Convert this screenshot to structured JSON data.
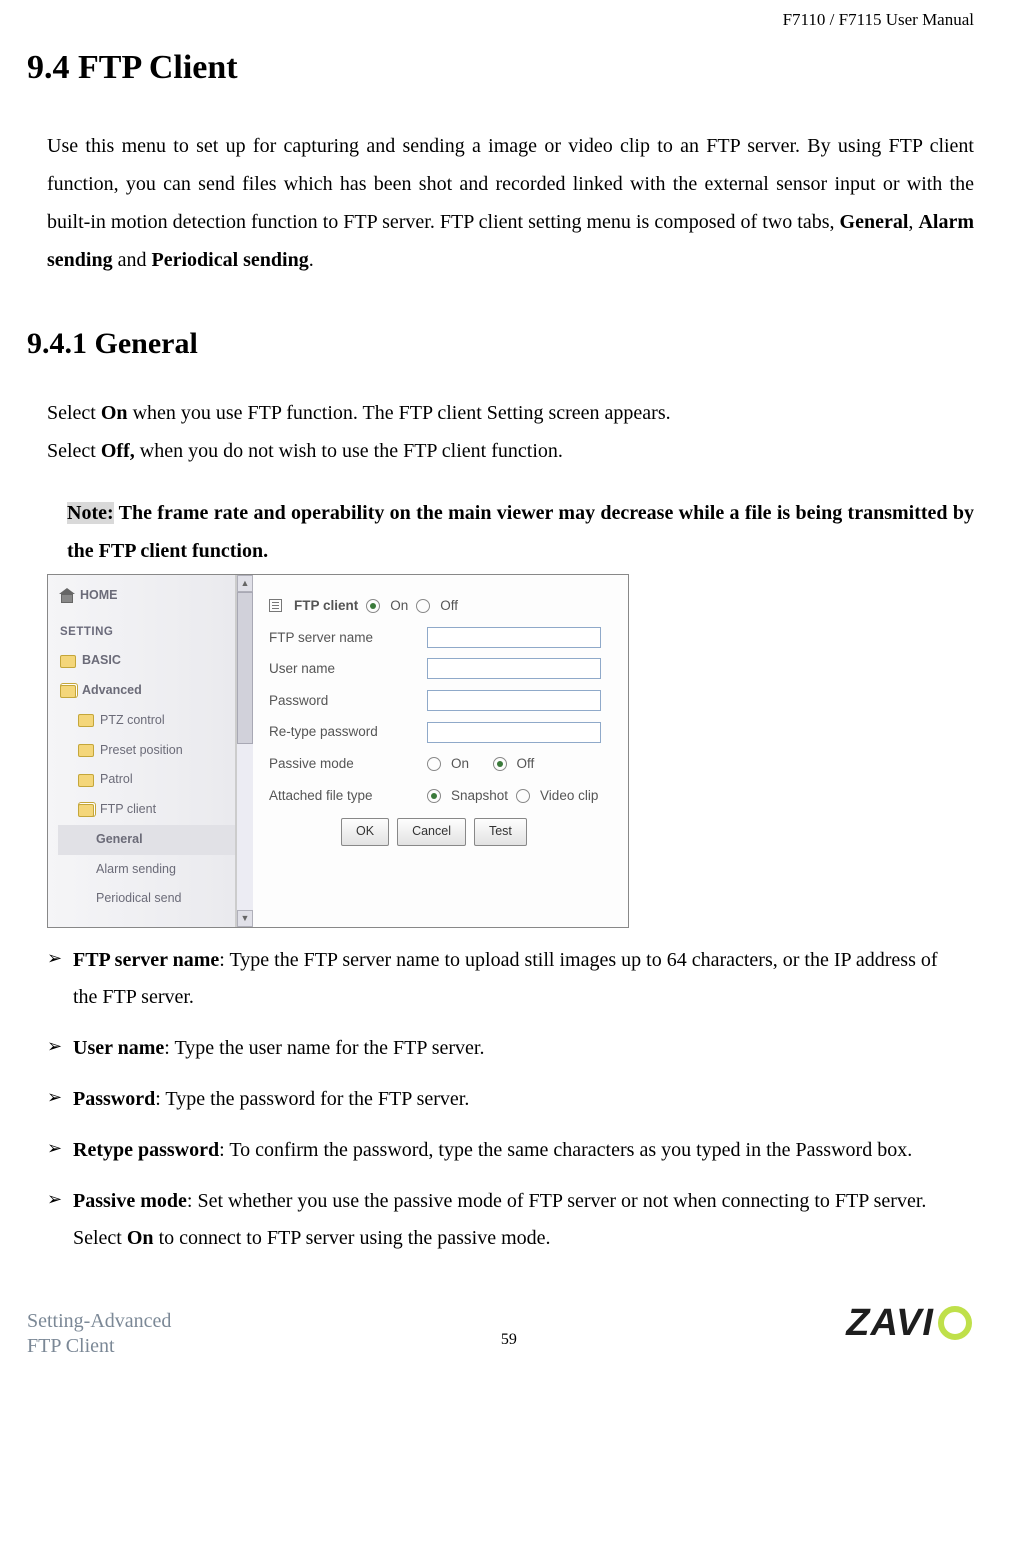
{
  "header": {
    "manual": "F7110 / F7115 User Manual"
  },
  "section": {
    "title": "9.4 FTP Client",
    "intro_a": "Use this menu to set up for capturing and sending a image or video clip to an FTP server. By using FTP client function, you can send files which has been shot and recorded linked with the external sensor input or with the built-in motion detection function to FTP server. FTP client setting menu is composed of two tabs, ",
    "intro_general": "General",
    "intro_comma": ", ",
    "intro_alarm": "Alarm sending",
    "intro_and": " and ",
    "intro_periodical": "Periodical sending",
    "intro_dot": "."
  },
  "subsection": {
    "title": "9.4.1 General",
    "sel_on_a": "Select ",
    "sel_on_b": "On",
    "sel_on_c": " when you use FTP function. The FTP client Setting screen appears.",
    "sel_off_a": "Select ",
    "sel_off_b": "Off,",
    "sel_off_c": " when you do not wish to use the FTP client function."
  },
  "note": {
    "label": "Note:",
    "text": " The frame rate and operability on the main viewer may decrease while a file is being transmitted by the FTP client function."
  },
  "nav": {
    "home": "HOME",
    "setting": "SETTING",
    "basic": "BASIC",
    "advanced": "Advanced",
    "ptz": "PTZ control",
    "preset": "Preset position",
    "patrol": "Patrol",
    "ftp": "FTP client",
    "general": "General",
    "alarm": "Alarm sending",
    "periodical": "Periodical send"
  },
  "form": {
    "title": "FTP client",
    "on": "On",
    "off": "Off",
    "server": "FTP server name",
    "user": "User name",
    "pass": "Password",
    "repass": "Re-type password",
    "passive": "Passive mode",
    "attach": "Attached file type",
    "snapshot": "Snapshot",
    "videoclip": "Video clip",
    "ok": "OK",
    "cancel": "Cancel",
    "test": "Test"
  },
  "descs": {
    "d1_t": "FTP server name",
    "d1_b": ": Type the FTP server name to upload still images up to 64 characters, or the IP address of the FTP server.",
    "d2_t": "User name",
    "d2_b": ": Type the user name for the FTP server.",
    "d3_t": "Password",
    "d3_b": ": Type the password for the FTP server.",
    "d4_t": "Retype password",
    "d4_b": ": To confirm the password, type the same characters as you typed in the Password box.",
    "d5_t": "Passive mode",
    "d5_b": ": Set whether you use the passive mode of FTP server or not when connecting to FTP server. Select ",
    "d5_on": "On",
    "d5_c": " to connect to FTP server using the passive mode."
  },
  "footer": {
    "left1": "Setting-Advanced",
    "left2": "FTP Client",
    "page": "59",
    "brand_pre": "ZAVI"
  }
}
